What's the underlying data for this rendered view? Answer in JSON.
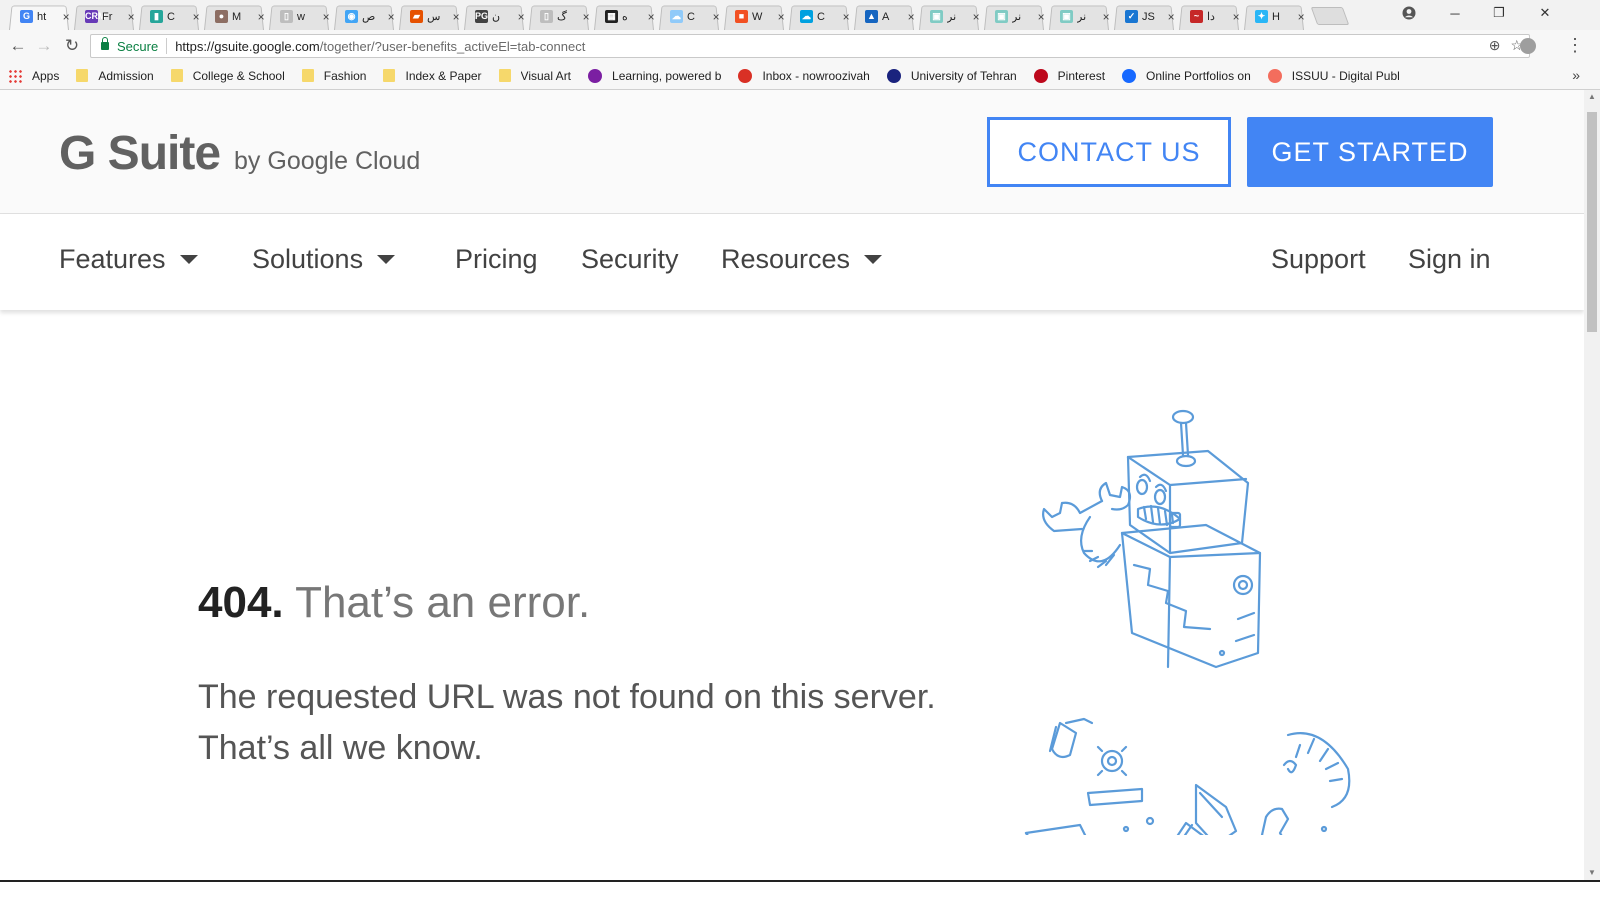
{
  "browser": {
    "tabs": [
      {
        "title": "ht",
        "icon": "google-g-icon",
        "color": "#4285f4",
        "glyph": "G",
        "active": true
      },
      {
        "title": "Fr",
        "icon": "crm-pro-icon",
        "color": "#673ab7",
        "glyph": "CRM"
      },
      {
        "title": "C",
        "icon": "colored-bars-icon",
        "color": "#26a69a",
        "glyph": "▮"
      },
      {
        "title": "M",
        "icon": "circle-logo-icon",
        "color": "#8d6e63",
        "glyph": "●"
      },
      {
        "title": "w",
        "icon": "page-icon",
        "color": "#bdbdbd",
        "glyph": "▯"
      },
      {
        "title": "ص",
        "icon": "bulb-icon",
        "color": "#42a5f5",
        "glyph": "◉"
      },
      {
        "title": "س",
        "icon": "stripe-logo-icon",
        "color": "#e65100",
        "glyph": "▰"
      },
      {
        "title": "ن",
        "icon": "pg-icon",
        "color": "#424242",
        "glyph": "PG"
      },
      {
        "title": "گ",
        "icon": "page-icon",
        "color": "#bdbdbd",
        "glyph": "▯"
      },
      {
        "title": "ه",
        "icon": "grid-logo-icon",
        "color": "#212121",
        "glyph": "▦"
      },
      {
        "title": "C",
        "icon": "cloud-icon",
        "color": "#90caf9",
        "glyph": "☁"
      },
      {
        "title": "W",
        "icon": "microsoft-icon",
        "color": "#f25022",
        "glyph": "■"
      },
      {
        "title": "C",
        "icon": "salesforce-cloud-icon",
        "color": "#00a1e0",
        "glyph": "☁"
      },
      {
        "title": "A",
        "icon": "triangle-logo-icon",
        "color": "#1565c0",
        "glyph": "▲"
      },
      {
        "title": "نر",
        "icon": "site-logo-icon",
        "color": "#80cbc4",
        "glyph": "▣"
      },
      {
        "title": "نر",
        "icon": "site-logo-icon",
        "color": "#80cbc4",
        "glyph": "▣"
      },
      {
        "title": "نر",
        "icon": "site-logo-icon",
        "color": "#80cbc4",
        "glyph": "▣"
      },
      {
        "title": "JS",
        "icon": "checkbox-logo-icon",
        "color": "#1976d2",
        "glyph": "✓"
      },
      {
        "title": "دا",
        "icon": "script-logo-icon",
        "color": "#c62828",
        "glyph": "~"
      },
      {
        "title": "H",
        "icon": "puzzle-logo-icon",
        "color": "#29b6f6",
        "glyph": "✦"
      }
    ],
    "omnibox": {
      "secure_label": "Secure",
      "url_host": "https://gsuite.google.com",
      "url_path": "/together/?user-benefits_activeEl=tab-connect"
    },
    "bookmarks": [
      {
        "label": "Apps",
        "icon": "apps-grid-icon",
        "type": "apps"
      },
      {
        "label": "Admission",
        "icon": "folder-icon",
        "type": "folder"
      },
      {
        "label": "College & School",
        "icon": "folder-icon",
        "type": "folder"
      },
      {
        "label": "Fashion",
        "icon": "folder-icon",
        "type": "folder"
      },
      {
        "label": "Index & Paper",
        "icon": "folder-icon",
        "type": "folder"
      },
      {
        "label": "Visual Art",
        "icon": "folder-icon",
        "type": "folder"
      },
      {
        "label": "Learning, powered b",
        "icon": "learning-logo-icon",
        "type": "site",
        "color": "#7b1fa2"
      },
      {
        "label": "Inbox - nowroozivah",
        "icon": "gmail-icon",
        "type": "site",
        "color": "#d93025"
      },
      {
        "label": "University of Tehran",
        "icon": "university-logo-icon",
        "type": "site",
        "color": "#1a237e"
      },
      {
        "label": "Pinterest",
        "icon": "pinterest-icon",
        "type": "site",
        "color": "#bd081c"
      },
      {
        "label": "Online Portfolios on",
        "icon": "behance-icon",
        "type": "site",
        "color": "#1769ff"
      },
      {
        "label": "ISSUU - Digital Publ",
        "icon": "issuu-icon",
        "type": "site",
        "color": "#f36d5d"
      }
    ]
  },
  "header": {
    "logo_main": "G Suite",
    "logo_sub": "by Google Cloud",
    "contact_label": "CONTACT US",
    "start_label": "GET STARTED"
  },
  "nav": {
    "features": "Features",
    "solutions": "Solutions",
    "pricing": "Pricing",
    "security": "Security",
    "resources": "Resources",
    "support": "Support",
    "signin": "Sign in"
  },
  "error": {
    "code": "404.",
    "title": "That’s an error.",
    "line1": "The requested URL was not found on this server.",
    "line2": "That’s all we know."
  },
  "colors": {
    "accent": "#4285f4",
    "robot_stroke": "#5b9bd9"
  }
}
